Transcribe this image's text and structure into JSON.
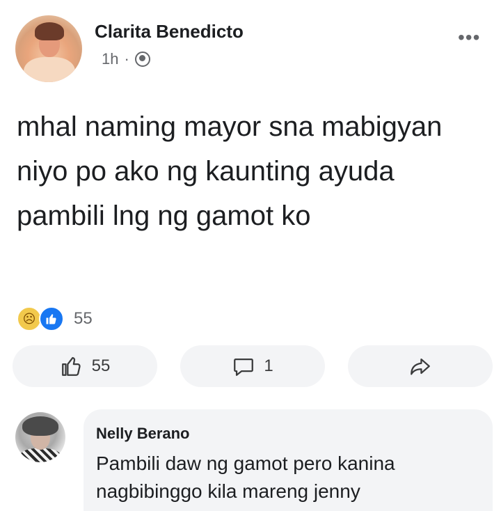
{
  "post": {
    "author": "Clarita Benedicto",
    "time": "1h",
    "separator": "·",
    "privacy_icon": "globe-icon",
    "more_icon": "more-options-icon",
    "more_label": "•••",
    "text": "mhal naming mayor sna mabigyan niyo po ako ng kaunting ayuda pambili lng ng gamot ko"
  },
  "reactions": {
    "icons": [
      "sad-reaction-icon",
      "like-reaction-icon"
    ],
    "count": "55"
  },
  "actions": {
    "like": {
      "icon": "like-icon",
      "label": "55"
    },
    "comment": {
      "icon": "comment-icon",
      "label": "1"
    },
    "share": {
      "icon": "share-icon",
      "label": ""
    }
  },
  "comment": {
    "author": "Nelly Berano",
    "text": "Pambili daw ng gamot pero kanina nagbibinggo kila mareng jenny"
  },
  "colors": {
    "like_blue": "#1877f2",
    "secondary_text": "#65676b",
    "pill_bg": "#f3f4f6",
    "sad_yellow": "#f2c94c"
  }
}
